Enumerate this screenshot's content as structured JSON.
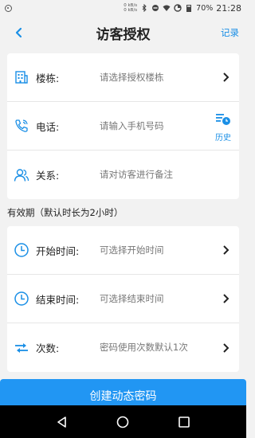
{
  "status_bar": {
    "net_up": "0 kB/s",
    "net_down": "0 kB/s",
    "battery": "70%",
    "time": "21:28"
  },
  "header": {
    "title": "访客授权",
    "right_action": "记录"
  },
  "form": {
    "building": {
      "label": "楼栋:",
      "placeholder": "请选择授权楼栋"
    },
    "phone": {
      "label": "电话:",
      "placeholder": "请输入手机号码",
      "history_label": "历史"
    },
    "relation": {
      "label": "关系:",
      "placeholder": "请对访客进行备注"
    }
  },
  "validity": {
    "section_title": "有效期（默认时长为2小时）",
    "start": {
      "label": "开始时间:",
      "placeholder": "可选择开始时间"
    },
    "end": {
      "label": "结束时间:",
      "placeholder": "可选择结束时间"
    },
    "count": {
      "label": "次数:",
      "placeholder": "密码使用次数默认1次"
    }
  },
  "submit_label": "创建动态密码",
  "colors": {
    "accent": "#1a8fe6",
    "button": "#2196f3",
    "background": "#f2f2f2"
  },
  "icons": [
    "building-icon",
    "phone-icon",
    "people-icon",
    "history-icon",
    "clock-icon",
    "transfer-icon",
    "chevron-right-icon"
  ]
}
